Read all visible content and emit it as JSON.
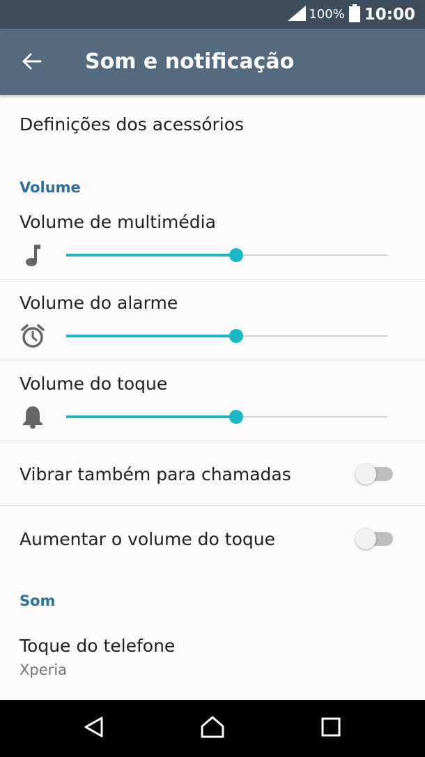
{
  "status_bar": {
    "battery_percent": "100%",
    "time": "10:00",
    "icons": [
      "signal-icon",
      "battery-icon"
    ]
  },
  "app_bar": {
    "back_icon": "arrow-left-icon",
    "title": "Som e notificação"
  },
  "items": {
    "accessories": "Definições dos acessórios"
  },
  "sections": {
    "volume": "Volume",
    "sound": "Som"
  },
  "volume_sliders": [
    {
      "label": "Volume de multimédia",
      "icon": "music-note-icon",
      "level": 0.53
    },
    {
      "label": "Volume do alarme",
      "icon": "alarm-clock-icon",
      "level": 0.53
    },
    {
      "label": "Volume do toque",
      "icon": "bell-icon",
      "level": 0.53
    }
  ],
  "toggles": [
    {
      "label": "Vibrar também para chamadas",
      "on": false
    },
    {
      "label": "Aumentar o volume do toque",
      "on": false
    }
  ],
  "ringtone": {
    "label": "Toque do telefone",
    "value": "Xperia"
  },
  "nav_bar": {
    "icons": [
      "back-triangle-icon",
      "home-icon",
      "recents-icon"
    ]
  },
  "colors": {
    "status_bar": "#3e4d5c",
    "app_bar": "#546a7e",
    "accent": "#1ab7c5",
    "section_header": "#2d6fa0"
  }
}
